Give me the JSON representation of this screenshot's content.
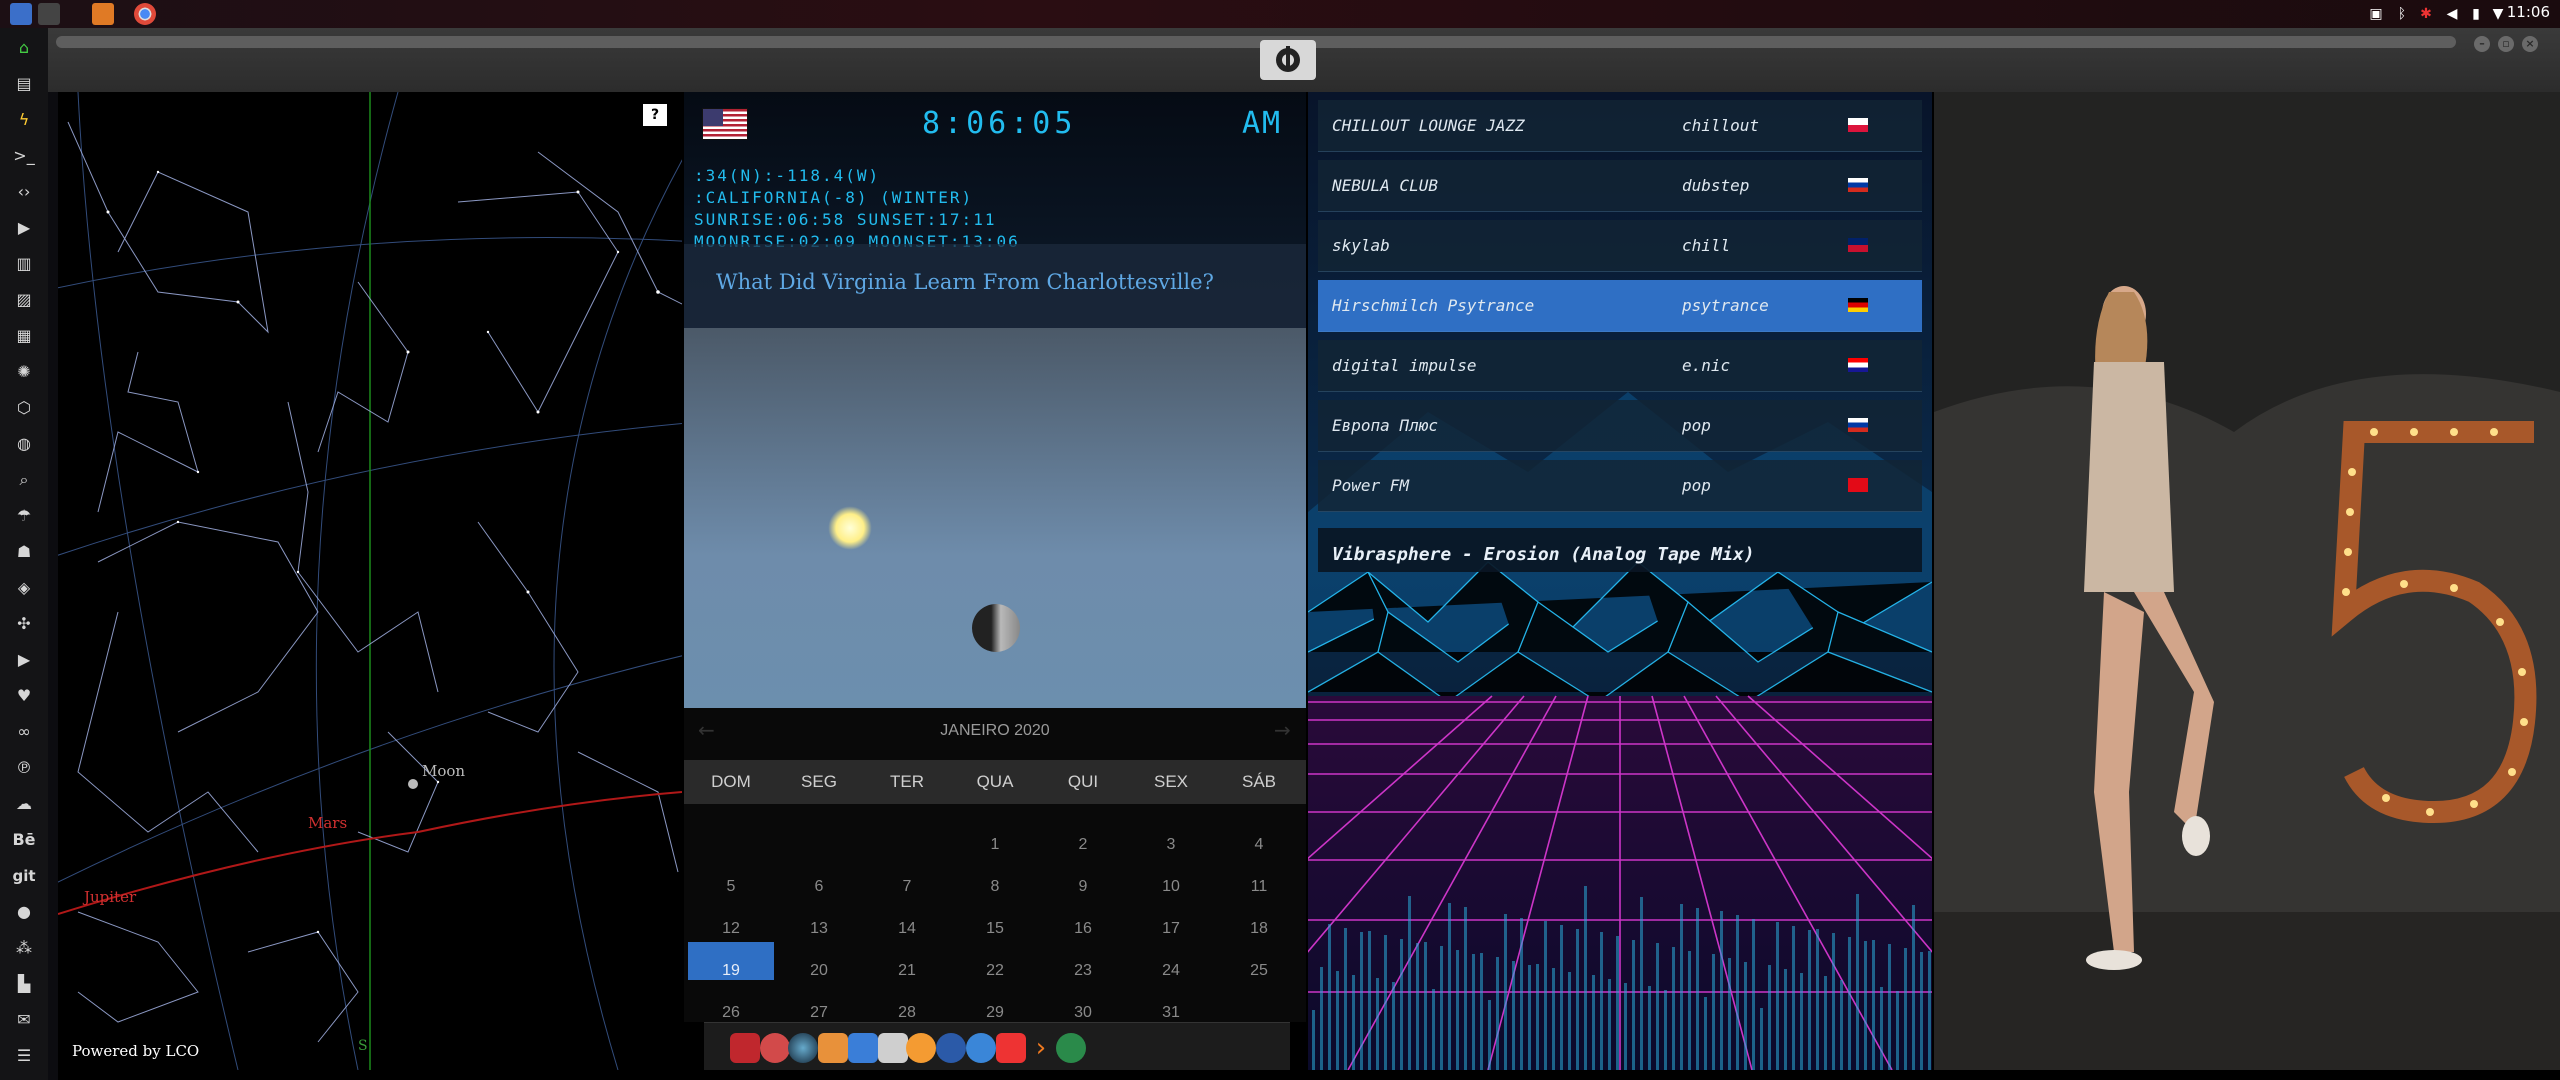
{
  "topbar": {
    "clock": "11:06"
  },
  "sky": {
    "labels": {
      "moon": "Moon",
      "mars": "Mars",
      "jupiter": "Jupiter"
    },
    "powered_by": "Powered by LCO",
    "help": "?",
    "south_marker": "S"
  },
  "clock_widget": {
    "time": "8:06:05",
    "ampm": "AM",
    "lines": [
      ":34(N):-118.4(W)",
      ":CALIFORNIA(-8) (WINTER)",
      "SUNRISE:06:58 SUNSET:17:11",
      "MOONRISE:02:09 MOONSET:13:06"
    ],
    "headline": "What Did Virginia Learn From Charlottesville?"
  },
  "calendar": {
    "month": "JANEIRO 2020",
    "day_names": [
      "DOM",
      "SEG",
      "TER",
      "QUA",
      "QUI",
      "SEX",
      "SÁB"
    ],
    "weeks": [
      [
        "",
        "",
        "",
        "1",
        "2",
        "3",
        "4"
      ],
      [
        "5",
        "6",
        "7",
        "8",
        "9",
        "10",
        "11"
      ],
      [
        "12",
        "13",
        "14",
        "15",
        "16",
        "17",
        "18"
      ],
      [
        "19",
        "20",
        "21",
        "22",
        "23",
        "24",
        "25"
      ],
      [
        "26",
        "27",
        "28",
        "29",
        "30",
        "31",
        ""
      ]
    ],
    "today": "19"
  },
  "radio": {
    "stations": [
      {
        "name": "CHILLOUT LOUNGE JAZZ",
        "genre": "chillout",
        "flag": "pl"
      },
      {
        "name": "NEBULA CLUB",
        "genre": "dubstep",
        "flag": "ru"
      },
      {
        "name": "skylab",
        "genre": "chill",
        "flag": "gb"
      },
      {
        "name": "Hirschmilch Psytrance",
        "genre": "psytrance",
        "flag": "de"
      },
      {
        "name": "digital impulse",
        "genre": "e.nic",
        "flag": "hr"
      },
      {
        "name": "Европа Плюс",
        "genre": "pop",
        "flag": "ru"
      },
      {
        "name": "Power FM",
        "genre": "pop",
        "flag": "tr"
      }
    ],
    "active_index": 3,
    "now_playing": "Vibrasphere - Erosion (Analog Tape Mix)"
  },
  "colors": {
    "accent": "#2f6fc4",
    "digital": "#22bcef",
    "headline": "#5fa8e4"
  }
}
